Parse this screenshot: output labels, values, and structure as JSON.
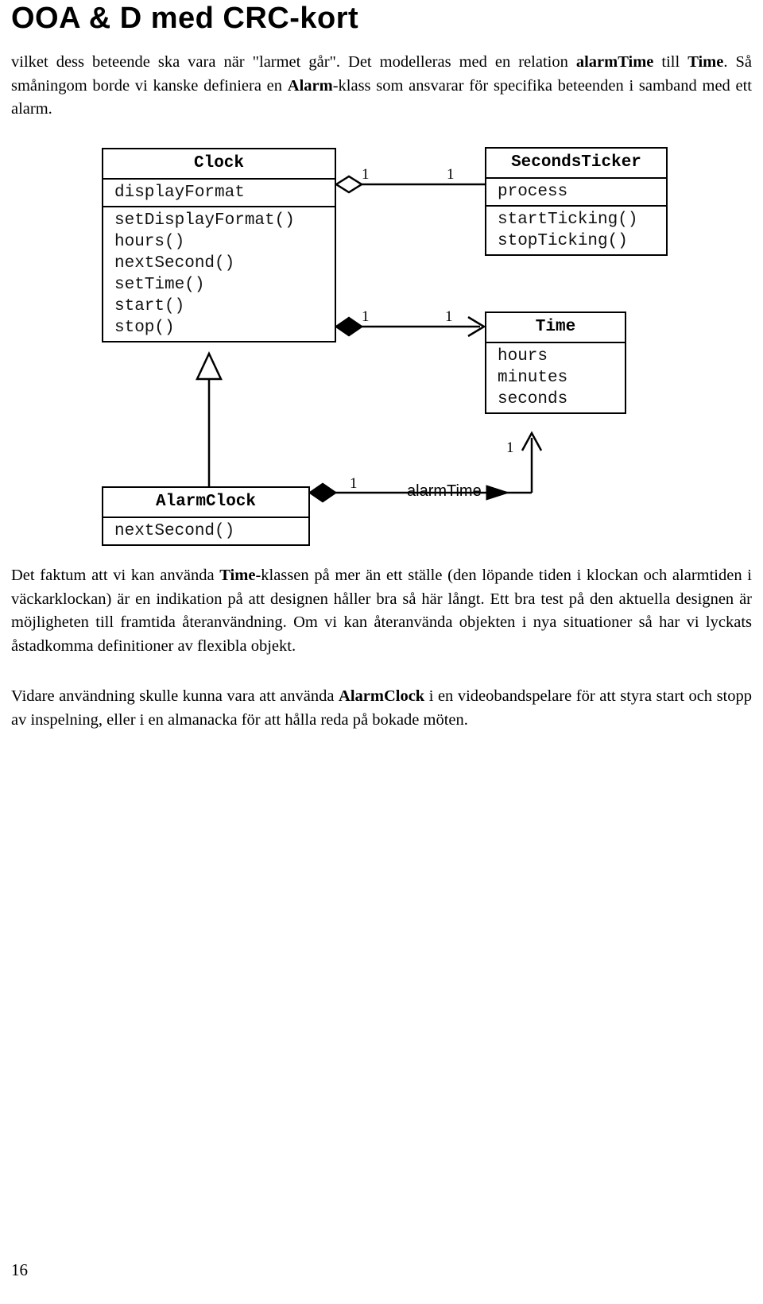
{
  "document": {
    "title": "OOA & D med CRC-kort",
    "page_number": "16",
    "intro_paragraph_html": "vilket dess beteende ska vara när \"larmet går\". Det modelleras med en relation <b>alarmTime</b> till <b>Time</b>. Så småningom borde vi kanske definiera en <b>Alarm</b>-klass som ansvarar för specifika beteenden i samband med ett alarm.",
    "body_paragraph_1_html": "Det faktum att vi kan använda <b>Time</b>-klassen på mer än ett ställe (den löpande tiden i klockan och alarmtiden i väckarklockan) är en indikation på att designen håller bra så här långt. Ett bra test på den aktuella designen är möjligheten till framtida återanvändning. Om vi kan återanvända objekten i nya situationer så har vi lyckats åstadkomma definitioner av flexibla objekt.",
    "body_paragraph_2_html": "Vidare användning skulle kunna vara att använda <b>AlarmClock</b> i en videobandspelare för att styra start och stopp av inspelning, eller i en almanacka för att hålla reda på bokade möten."
  },
  "diagram": {
    "type": "uml-class-diagram",
    "line_color": "#000000",
    "classes": [
      {
        "id": "clock",
        "name": "Clock",
        "attributes": [
          "displayFormat"
        ],
        "operations": [
          "setDisplayFormat()",
          "hours()",
          "nextSecond()",
          "setTime()",
          "start()",
          "stop()"
        ]
      },
      {
        "id": "secondsticker",
        "name": "SecondsTicker",
        "attributes": [
          "process"
        ],
        "operations": [
          "startTicking()",
          "stopTicking()"
        ]
      },
      {
        "id": "time",
        "name": "Time",
        "attributes": [
          "hours",
          "minutes",
          "seconds"
        ],
        "operations": []
      },
      {
        "id": "alarmclock",
        "name": "AlarmClock",
        "attributes": [],
        "operations": [
          "nextSecond()"
        ]
      }
    ],
    "relationships": [
      {
        "id": "clock-secondsticker",
        "kind": "aggregation",
        "from": "Clock",
        "to": "SecondsTicker",
        "source_multiplicity": "1",
        "target_multiplicity": "1",
        "label": ""
      },
      {
        "id": "clock-time",
        "kind": "composition",
        "from": "Clock",
        "to": "Time",
        "source_multiplicity": "1",
        "target_multiplicity": "1",
        "label": ""
      },
      {
        "id": "alarmclock-clock",
        "kind": "generalization",
        "from": "AlarmClock",
        "to": "Clock",
        "source_multiplicity": "",
        "target_multiplicity": "",
        "label": ""
      },
      {
        "id": "alarmclock-time",
        "kind": "composition",
        "from": "AlarmClock",
        "to": "Time",
        "source_multiplicity": "1",
        "target_multiplicity": "1",
        "label": "alarmTime"
      }
    ]
  }
}
